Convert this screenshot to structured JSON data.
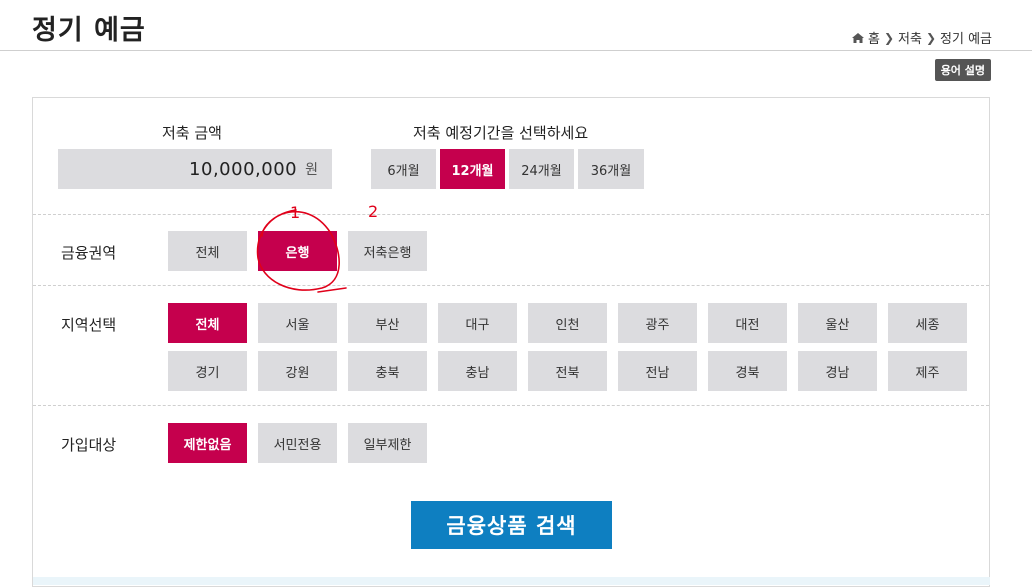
{
  "header": {
    "title": "정기 예금",
    "breadcrumb": {
      "home": "홈",
      "section": "저축",
      "current": "정기 예금"
    },
    "glossary_button": "용어 설명"
  },
  "amount": {
    "label": "저축 금액",
    "value": "10,000,000",
    "unit": "원"
  },
  "period": {
    "label": "저축 예정기간을 선택하세요",
    "options": [
      "6개월",
      "12개월",
      "24개월",
      "36개월"
    ],
    "selected": "12개월"
  },
  "financial_sector": {
    "label": "금융권역",
    "options": [
      "전체",
      "은행",
      "저축은행"
    ],
    "selected": "은행"
  },
  "region": {
    "label": "지역선택",
    "options_row1": [
      "전체",
      "서울",
      "부산",
      "대구",
      "인천",
      "광주",
      "대전",
      "울산",
      "세종"
    ],
    "options_row2": [
      "경기",
      "강원",
      "충북",
      "충남",
      "전북",
      "전남",
      "경북",
      "경남",
      "제주"
    ],
    "selected": "전체"
  },
  "eligibility": {
    "label": "가입대상",
    "options": [
      "제한없음",
      "서민전용",
      "일부제한"
    ],
    "selected": "제한없음"
  },
  "search_button": "금융상품 검색",
  "annotations": {
    "mark1": "1",
    "mark2": "2",
    "color": "#e0001a"
  },
  "colors": {
    "accent": "#c5004d",
    "search": "#0e7fc1",
    "inactive": "#dcdcdf"
  }
}
